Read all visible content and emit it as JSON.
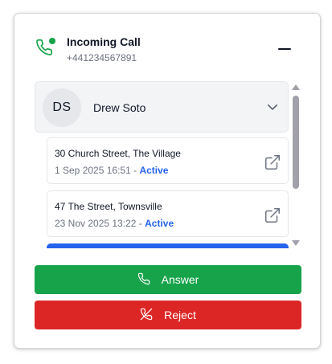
{
  "call": {
    "title": "Incoming Call",
    "number": "+441234567891",
    "icon": "phone-icon",
    "indicator_color": "#16a34a",
    "minimize_icon": "minus-icon"
  },
  "contact": {
    "initials": "DS",
    "name": "Drew Soto",
    "expand_icon": "chevron-down-icon"
  },
  "addresses": [
    {
      "address": "30 Church Street, The Village",
      "date": "1 Sep 2025 16:51",
      "separator": "-",
      "status": "Active",
      "open_icon": "external-link-icon"
    },
    {
      "address": "47 The Street, Townsville",
      "date": "23 Nov 2025 13:22",
      "separator": "-",
      "status": "Active",
      "open_icon": "external-link-icon"
    }
  ],
  "actions": {
    "answer_label": "Answer",
    "answer_icon": "phone-icon",
    "answer_color": "#16a34a",
    "reject_label": "Reject",
    "reject_icon": "phone-off-icon",
    "reject_color": "#dc2626"
  },
  "colors": {
    "status_active": "#2563eb",
    "accent_blue": "#2563eb"
  }
}
